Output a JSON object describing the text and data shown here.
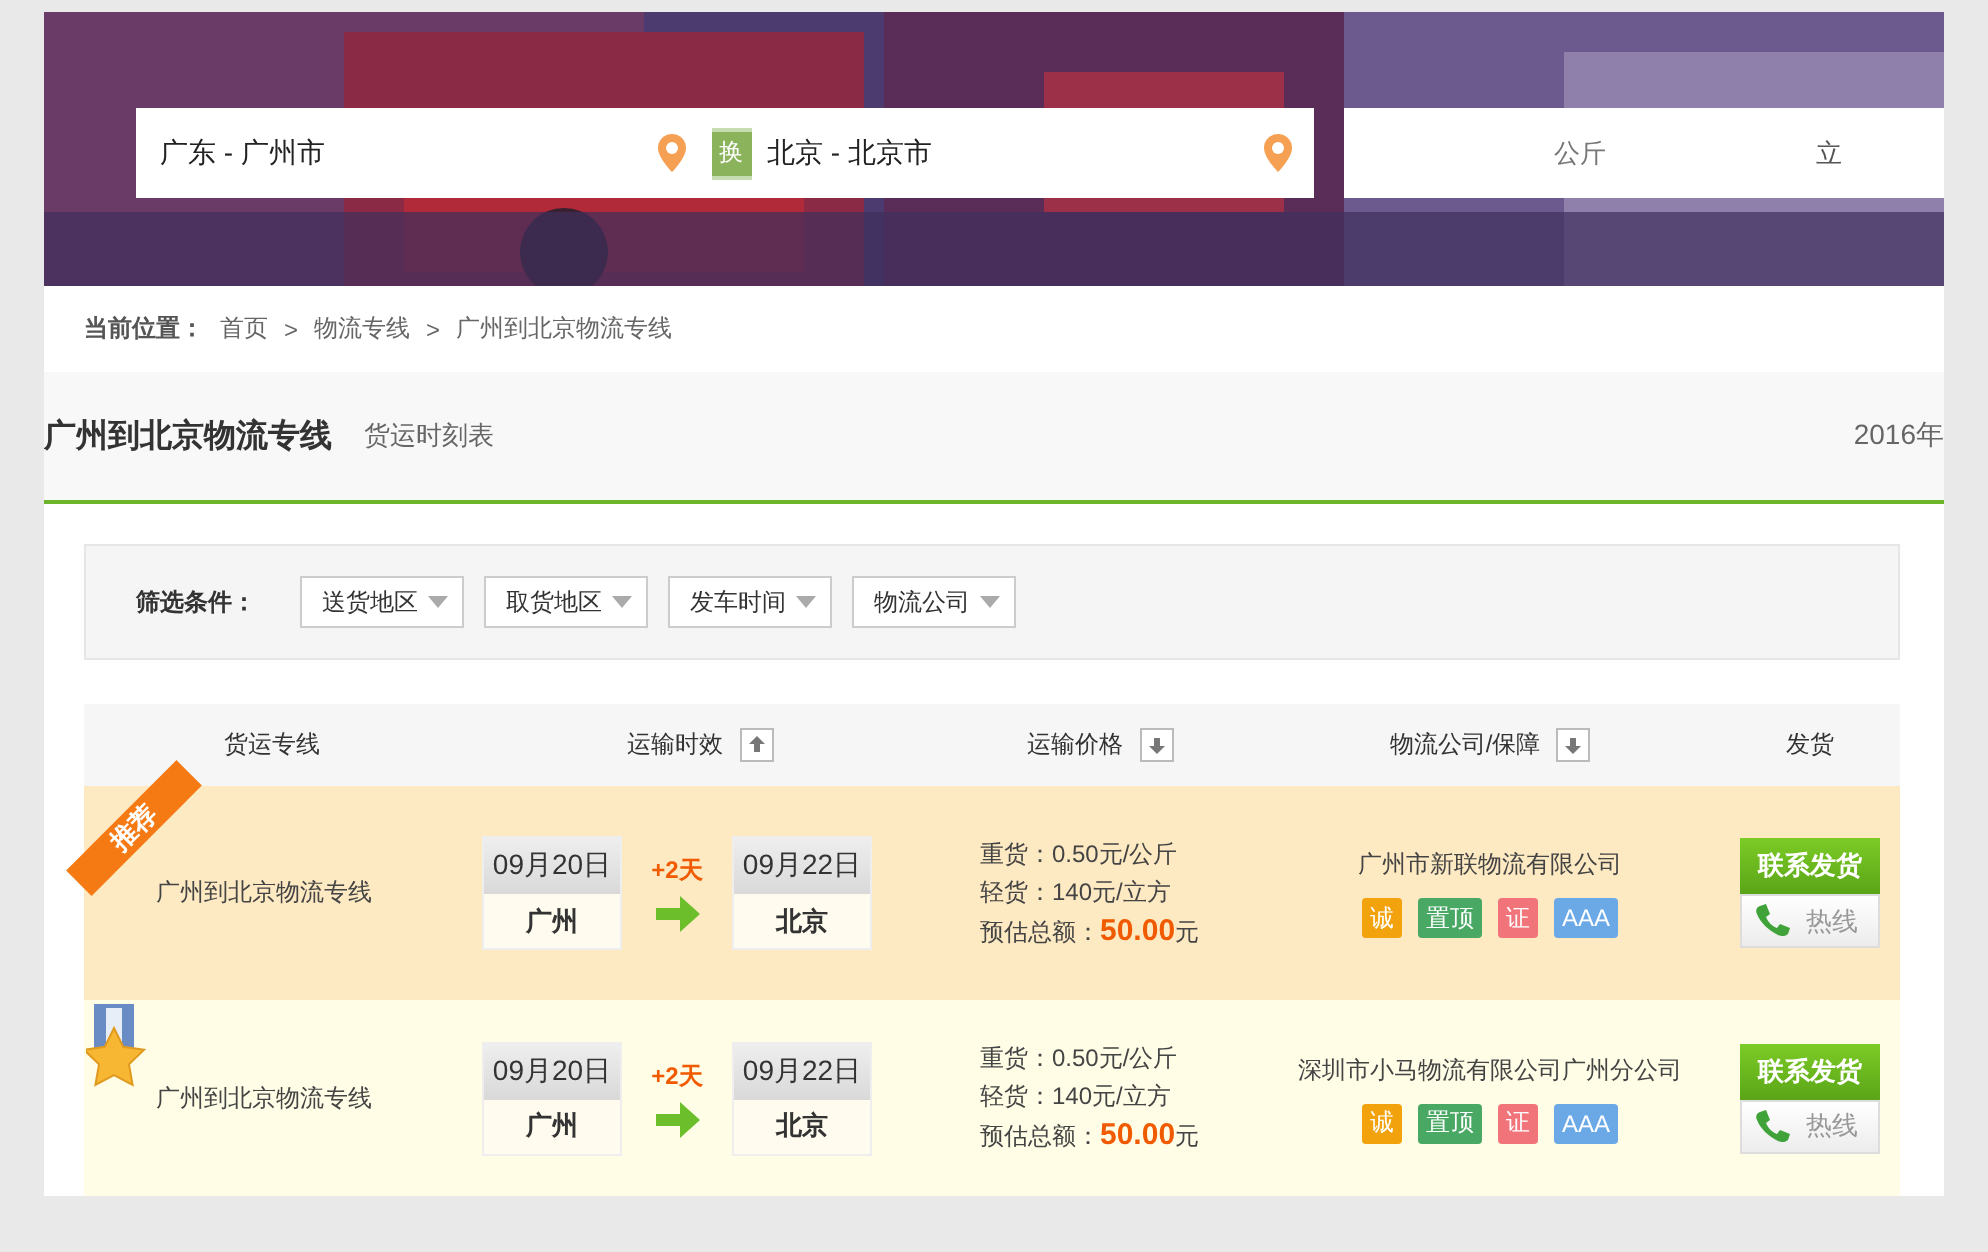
{
  "search": {
    "from": "广东 - 广州市",
    "swap": "换",
    "to": "北京 - 北京市",
    "unit": "公斤",
    "unit_2": "立"
  },
  "breadcrumb": {
    "label": "当前位置：",
    "items": [
      "首页",
      "物流专线",
      "广州到北京物流专线"
    ],
    "separator": ">"
  },
  "heading": {
    "title": "广州到北京物流专线",
    "subtitle": "货运时刻表",
    "date": "2016年"
  },
  "filters": {
    "label": "筛选条件：",
    "dropdowns": [
      "送货地区",
      "取货地区",
      "发车时间",
      "物流公司"
    ]
  },
  "table": {
    "columns": [
      {
        "label": "货运专线",
        "kind": "plain"
      },
      {
        "label": "运输时效",
        "kind": "ascending"
      },
      {
        "label": "运输价格",
        "kind": "descending"
      },
      {
        "label": "物流公司/保障",
        "kind": "descending"
      },
      {
        "label": "发货",
        "kind": "plain"
      }
    ],
    "rows": [
      {
        "kind": "recommended",
        "badge": "推荐",
        "route": "广州到北京物流专线",
        "depart": {
          "date": "09月20日",
          "city": "广州"
        },
        "duration": "+2天",
        "arrive": {
          "date": "09月22日",
          "city": "北京"
        },
        "prices": [
          "重货：0.50元/公斤",
          "轻货：140元/立方"
        ],
        "total_label": "预估总额：",
        "total": "50.00",
        "total_unit": "元",
        "company": "广州市新联物流有限公司",
        "tags": [
          {
            "text": "诚",
            "color": "#f2a20c"
          },
          {
            "text": "置顶",
            "color": "#4aa865"
          },
          {
            "text": "证",
            "color": "#f07479"
          },
          {
            "text": "AAA",
            "color": "#6ba8e6"
          }
        ],
        "contact": "联系发货",
        "hotline": "热线"
      },
      {
        "kind": "medal",
        "route": "广州到北京物流专线",
        "depart": {
          "date": "09月20日",
          "city": "广州"
        },
        "duration": "+2天",
        "arrive": {
          "date": "09月22日",
          "city": "北京"
        },
        "prices": [
          "重货：0.50元/公斤",
          "轻货：140元/立方"
        ],
        "total_label": "预估总额：",
        "total": "50.00",
        "total_unit": "元",
        "company": "深圳市小马物流有限公司广州分公司",
        "tags": [
          {
            "text": "诚",
            "color": "#f2a20c"
          },
          {
            "text": "置顶",
            "color": "#4aa865"
          },
          {
            "text": "证",
            "color": "#f07479"
          },
          {
            "text": "AAA",
            "color": "#6ba8e6"
          }
        ],
        "contact": "联系发货",
        "hotline": "热线"
      }
    ]
  }
}
